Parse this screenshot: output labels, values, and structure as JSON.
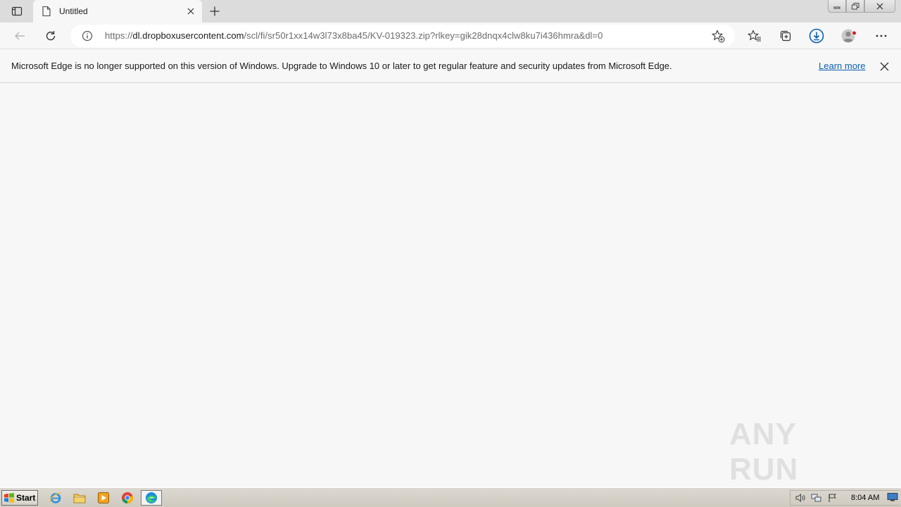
{
  "tab": {
    "title": "Untitled"
  },
  "address_bar": {
    "url_scheme": "https://",
    "url_host": "dl.dropboxusercontent.com",
    "url_path": "/scl/fi/sr50r1xx14w3l73x8ba45/KV-019323.zip?rlkey=gik28dnqx4clw8ku7i436hmra&dl=0"
  },
  "infobar": {
    "message": "Microsoft Edge is no longer supported on this version of Windows. Upgrade to Windows 10 or later to get regular feature and security updates from Microsoft Edge.",
    "link_label": "Learn more"
  },
  "watermark": {
    "text": "ANY RUN"
  },
  "taskbar": {
    "start_label": "Start",
    "clock": "8:04 AM",
    "pinned": [
      "internet-explorer-icon",
      "folder-icon",
      "media-player-icon",
      "chrome-icon",
      "edge-icon"
    ]
  },
  "colors": {
    "accent_download": "#0b5fb0",
    "link": "#0b5fb0",
    "profile_badge": "#d81b1b"
  }
}
